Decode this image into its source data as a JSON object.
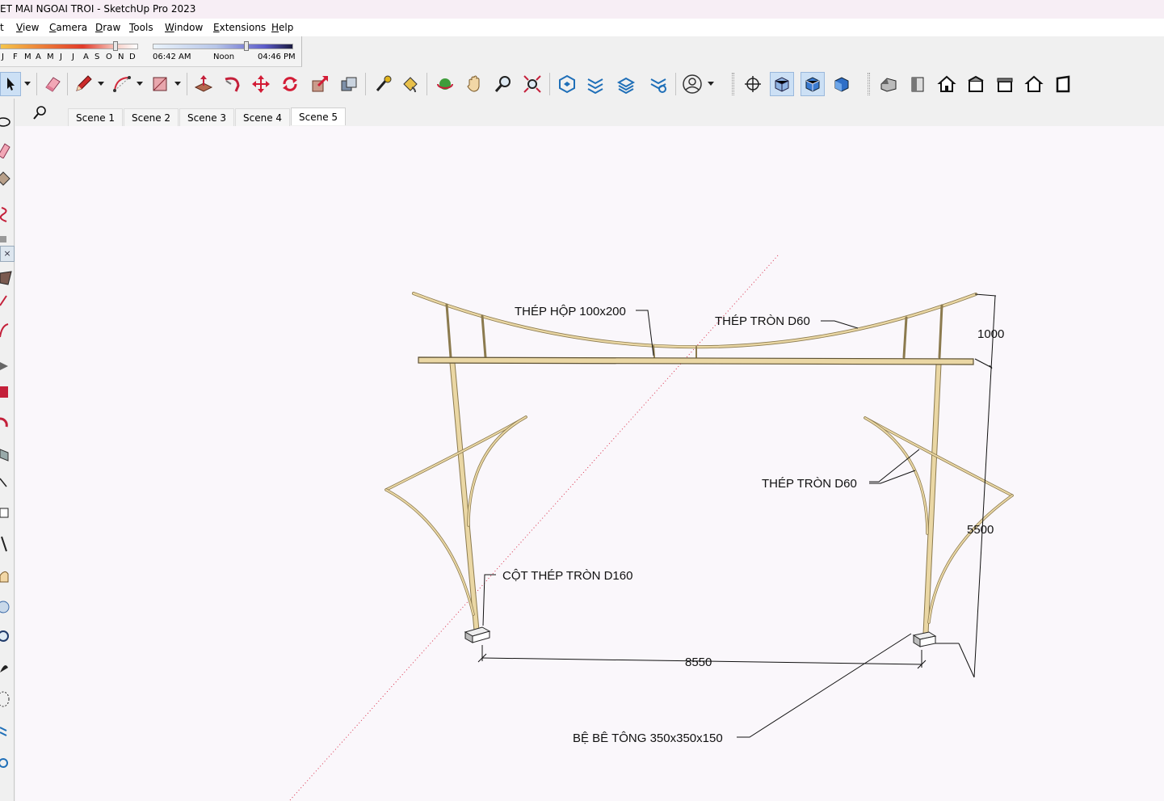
{
  "window": {
    "title": "ET MAI NGOAI TROI - SketchUp Pro 2023"
  },
  "menu": {
    "items": [
      "t",
      "View",
      "Camera",
      "Draw",
      "Tools",
      "Window",
      "Extensions",
      "Help"
    ]
  },
  "shadows": {
    "months": [
      "J",
      "F",
      "M",
      "A",
      "M",
      "J",
      "J",
      "A",
      "S",
      "O",
      "N",
      "D"
    ],
    "sunrise": "06:42 AM",
    "noon": "Noon",
    "sunset": "04:46 PM",
    "date_slider_fraction": 0.83,
    "time_slider_fraction": 0.68
  },
  "scenes": {
    "tabs": [
      "Scene 1",
      "Scene 2",
      "Scene 3",
      "Scene 4",
      "Scene 5"
    ],
    "active_index": 4
  },
  "annotations": {
    "box_beam": "THÉP HỘP 100x200",
    "round_top": "THÉP TRÒN D60",
    "round_side": "THÉP TRÒN D60",
    "column": "CỘT THÉP TRÒN D160",
    "footing": "BỆ BÊ TÔNG 350x350x150"
  },
  "dimensions": {
    "top_height": "1000",
    "total_height": "5500",
    "span": "8550"
  },
  "colors": {
    "steel": "#ead7a4",
    "steel_edge": "#8b7a4e",
    "axis_red": "#d9304a",
    "viewport_bg": "#faf7fb",
    "active_tab": "#ffffff"
  }
}
